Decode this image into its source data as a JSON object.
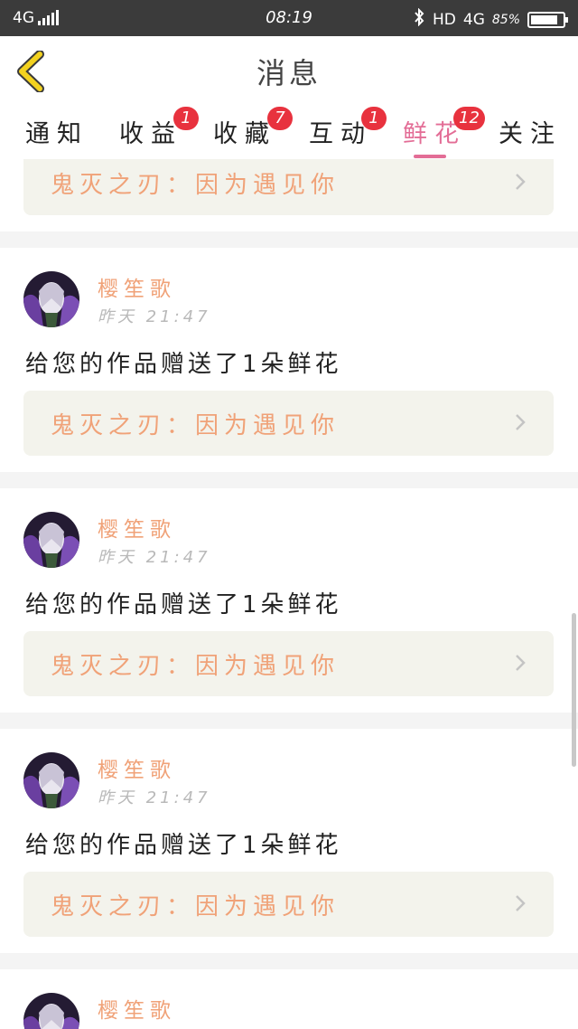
{
  "status_bar": {
    "network_left": "4G",
    "time": "08:19",
    "hd_label": "HD",
    "network_right": "4G",
    "battery_percent": "85%",
    "battery_level": 0.85
  },
  "header": {
    "title": "消息",
    "back_icon": "chevron-left-icon",
    "back_color": "#f3d21f"
  },
  "tabs": [
    {
      "label": "通知",
      "badge": ""
    },
    {
      "label": "收益",
      "badge": "1"
    },
    {
      "label": "收藏",
      "badge": "7"
    },
    {
      "label": "互动",
      "badge": "1"
    },
    {
      "label": "鲜花",
      "badge": "12",
      "active": true
    },
    {
      "label": "关注",
      "badge": ""
    }
  ],
  "colors": {
    "accent": "#e36d96",
    "badge": "#e8323e",
    "name": "#f0a278",
    "link_bg": "#f3f3ec"
  },
  "partial_top": {
    "work_text": "鬼灭之刃：因为遇见你"
  },
  "messages": [
    {
      "user": "樱笙歌",
      "time": "昨天 21:47",
      "text": "给您的作品赠送了1朵鲜花",
      "work_text": "鬼灭之刃：因为遇见你"
    },
    {
      "user": "樱笙歌",
      "time": "昨天 21:47",
      "text": "给您的作品赠送了1朵鲜花",
      "work_text": "鬼灭之刃：因为遇见你"
    },
    {
      "user": "樱笙歌",
      "time": "昨天 21:47",
      "text": "给您的作品赠送了1朵鲜花",
      "work_text": "鬼灭之刃：因为遇见你"
    },
    {
      "user": "樱笙歌"
    }
  ]
}
